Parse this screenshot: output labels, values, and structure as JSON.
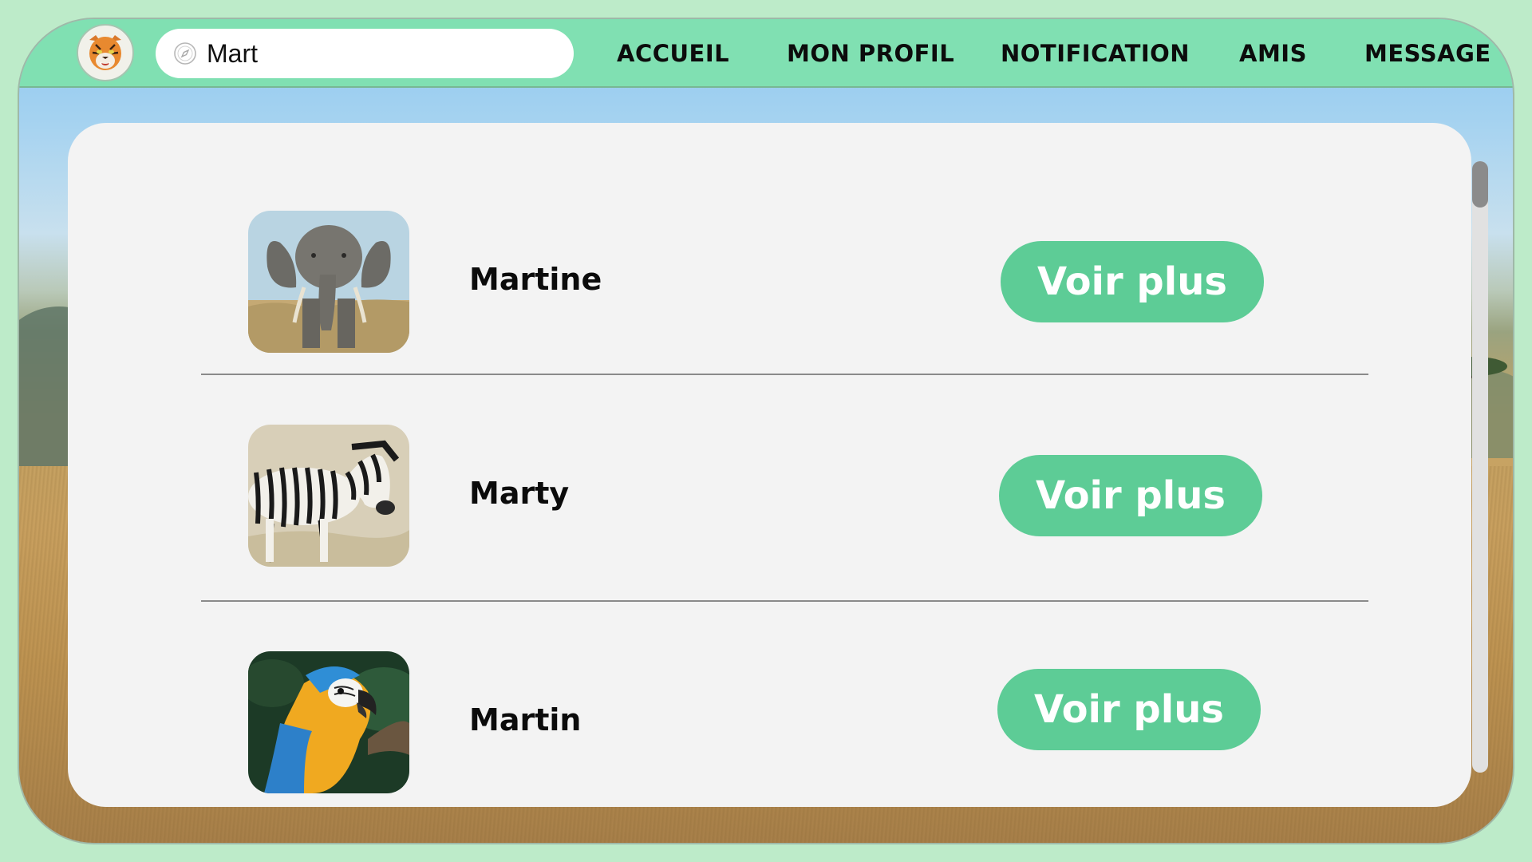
{
  "header": {
    "logo_icon": "tiger-face-icon",
    "search": {
      "value": "Mart",
      "placeholder": "",
      "icon": "compass-icon"
    },
    "nav": [
      {
        "label": "ACCUEIL"
      },
      {
        "label": "MON PROFIL"
      },
      {
        "label": "NOTIFICATION"
      },
      {
        "label": "AMIS"
      },
      {
        "label": "MESSAGE"
      }
    ]
  },
  "results": [
    {
      "name": "Martine",
      "photo": "elephant-photo",
      "button": "Voir plus"
    },
    {
      "name": "Marty",
      "photo": "zebra-photo",
      "button": "Voir plus"
    },
    {
      "name": "Martin",
      "photo": "macaw-photo",
      "button": "Voir plus"
    }
  ],
  "colors": {
    "nav_bar": "#80e0b2",
    "button": "#5dcc96",
    "page_border": "#bdebc9",
    "card": "#f3f3f3"
  }
}
